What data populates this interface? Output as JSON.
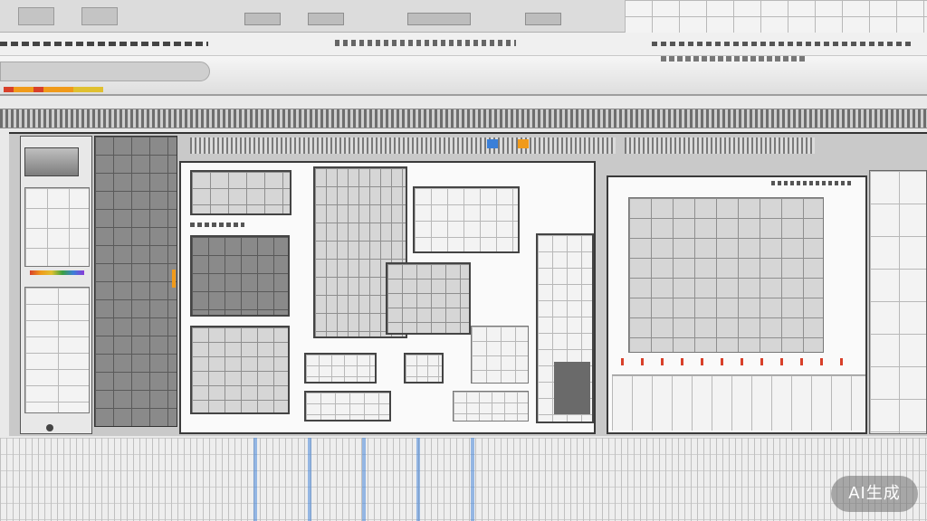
{
  "watermark": {
    "text": "AI生成"
  },
  "colors": {
    "accent_orange": "#f09a1a",
    "accent_blue": "#3a7fd8",
    "accent_red": "#d8402a",
    "accent_magenta": "#d64fb2",
    "frame_dark": "#3a3a3a",
    "background": "#e9e9e9"
  },
  "icons": [
    "window-tab-icon",
    "toolbar-glyph-icon",
    "scroll-handle-icon"
  ]
}
